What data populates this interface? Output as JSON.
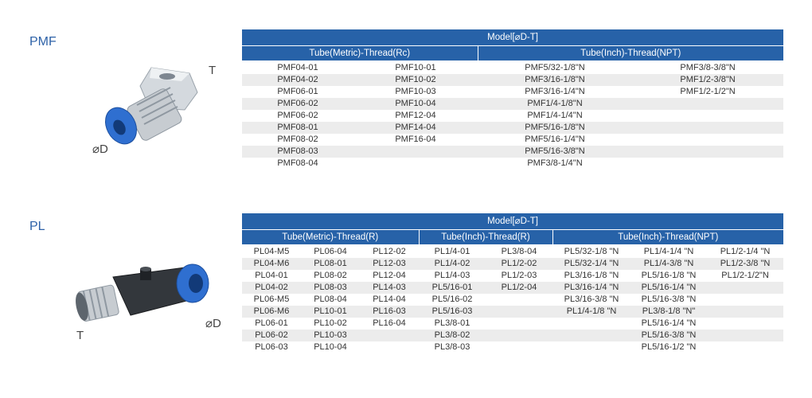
{
  "pmf": {
    "label": "PMF",
    "t_label": "T",
    "d_label": "⌀D",
    "model_header": "Model[⌀D-T]",
    "group_headers": [
      "Tube(Metric)-Thread(Rc)",
      "Tube(Inch)-Thread(NPT)"
    ],
    "rows": [
      [
        "PMF04-01",
        "PMF10-01",
        "PMF5/32-1/8\"N",
        "PMF3/8-3/8\"N"
      ],
      [
        "PMF04-02",
        "PMF10-02",
        "PMF3/16-1/8\"N",
        "PMF1/2-3/8\"N"
      ],
      [
        "PMF06-01",
        "PMF10-03",
        "PMF3/16-1/4\"N",
        "PMF1/2-1/2\"N"
      ],
      [
        "PMF06-02",
        "PMF10-04",
        "PMF1/4-1/8\"N",
        ""
      ],
      [
        "PMF06-02",
        "PMF12-04",
        "PMF1/4-1/4\"N",
        ""
      ],
      [
        "PMF08-01",
        "PMF14-04",
        "PMF5/16-1/8\"N",
        ""
      ],
      [
        "PMF08-02",
        "PMF16-04",
        "PMF5/16-1/4\"N",
        ""
      ],
      [
        "PMF08-03",
        "",
        "PMF5/16-3/8\"N",
        ""
      ],
      [
        "PMF08-04",
        "",
        "PMF3/8-1/4\"N",
        ""
      ]
    ]
  },
  "pl": {
    "label": "PL",
    "t_label": "T",
    "d_label": "⌀D",
    "model_header": "Model[⌀D-T]",
    "group_headers": [
      "Tube(Metric)-Thread(R)",
      "Tube(Inch)-Thread(R)",
      "Tube(Inch)-Thread(NPT)"
    ],
    "rows": [
      [
        "PL04-M5",
        "PL06-04",
        "PL12-02",
        "PL1/4-01",
        "PL3/8-04",
        "PL5/32-1/8 \"N",
        "PL1/4-1/4 \"N",
        "PL1/2-1/4 \"N"
      ],
      [
        "PL04-M6",
        "PL08-01",
        "PL12-03",
        "PL1/4-02",
        "PL1/2-02",
        "PL5/32-1/4 \"N",
        "PL1/4-3/8 \"N",
        "PL1/2-3/8 \"N"
      ],
      [
        "PL04-01",
        "PL08-02",
        "PL12-04",
        "PL1/4-03",
        "PL1/2-03",
        "PL3/16-1/8 \"N",
        "PL5/16-1/8 \"N",
        "PL1/2-1/2\"N"
      ],
      [
        "PL04-02",
        "PL08-03",
        "PL14-03",
        "PL5/16-01",
        "PL1/2-04",
        "PL3/16-1/4 \"N",
        "PL5/16-1/4 \"N",
        ""
      ],
      [
        "PL06-M5",
        "PL08-04",
        "PL14-04",
        "PL5/16-02",
        "",
        "PL3/16-3/8 \"N",
        "PL5/16-3/8 \"N",
        ""
      ],
      [
        "PL06-M6",
        "PL10-01",
        "PL16-03",
        "PL5/16-03",
        "",
        "PL1/4-1/8 \"N",
        "PL3/8-1/8 \"N\"",
        ""
      ],
      [
        "PL06-01",
        "PL10-02",
        "PL16-04",
        "PL3/8-01",
        "",
        "",
        "PL5/16-1/4 \"N",
        ""
      ],
      [
        "PL06-02",
        "PL10-03",
        "",
        "PL3/8-02",
        "",
        "",
        "PL5/16-3/8 \"N",
        ""
      ],
      [
        "PL06-03",
        "PL10-04",
        "",
        "PL3/8-03",
        "",
        "",
        "PL5/16-1/2 \"N",
        ""
      ]
    ]
  },
  "colors": {
    "header_blue": "#2762a8",
    "label_blue": "#2e62a8",
    "row_alt": "#ececec",
    "fitting_blue": "#2f6fd0"
  }
}
